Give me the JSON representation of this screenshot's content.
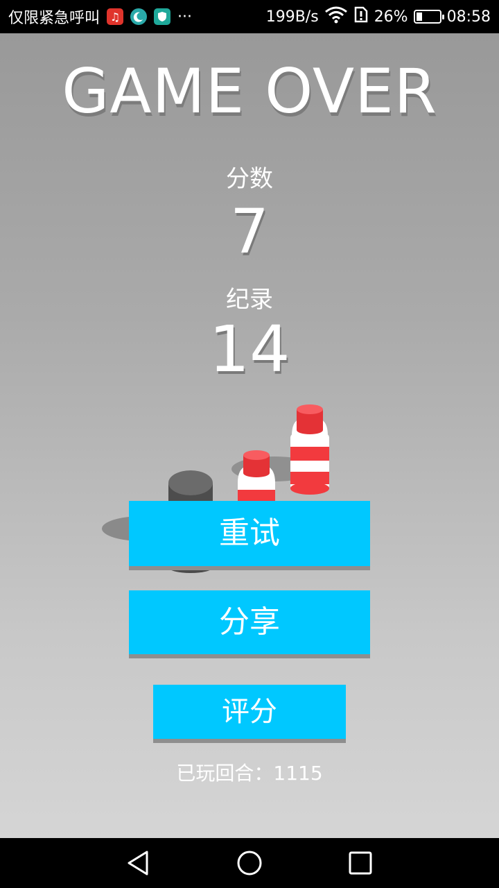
{
  "status_bar": {
    "emergency_text": "仅限紧急呼叫",
    "more": "···",
    "speed": "199B/s",
    "battery_percent": "26%",
    "battery_level": 0.26,
    "time": "08:58",
    "app_icons": [
      {
        "name": "music-app-icon",
        "color": "#e0342c"
      },
      {
        "name": "moon-app-icon",
        "color": "#2aa9a9"
      },
      {
        "name": "shield-app-icon",
        "color": "#1fa89a"
      }
    ]
  },
  "game": {
    "title": "GAME OVER",
    "score_label": "分数",
    "score_value": "7",
    "best_label": "纪录",
    "best_value": "14",
    "buttons": {
      "retry": "重试",
      "share": "分享",
      "rate": "评分"
    },
    "rounds_label": "已玩回合：",
    "rounds_value": "1115",
    "colors": {
      "button": "#00c8ff",
      "bottle_red": "#f23a3e",
      "bottle_white": "#ffffff",
      "puck": "#5a5a5a"
    }
  },
  "nav_bar": {
    "icons": [
      "back-icon",
      "home-icon",
      "recents-icon"
    ]
  }
}
